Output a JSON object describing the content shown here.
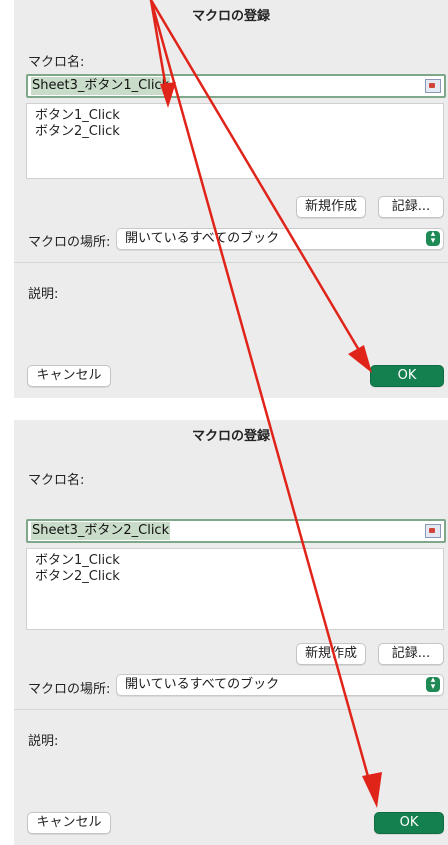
{
  "dialogs": [
    {
      "title": "マクロの登録",
      "macro_name_label": "マクロ名:",
      "macro_name_value": "Sheet3_ボタン1_Click",
      "macros": [
        "ボタン1_Click",
        "ボタン2_Click"
      ],
      "new_button": "新規作成",
      "record_button": "記録...",
      "location_label": "マクロの場所:",
      "location_value": "開いているすべてのブック",
      "description_label": "説明:",
      "cancel_button": "キャンセル",
      "ok_button": "OK"
    },
    {
      "title": "マクロの登録",
      "macro_name_label": "マクロ名:",
      "macro_name_value": "Sheet3_ボタン2_Click",
      "macros": [
        "ボタン1_Click",
        "ボタン2_Click"
      ],
      "new_button": "新規作成",
      "record_button": "記録...",
      "location_label": "マクロの場所:",
      "location_value": "開いているすべてのブック",
      "description_label": "説明:",
      "cancel_button": "キャンセル",
      "ok_button": "OK"
    }
  ],
  "colors": {
    "ok_green": "#15804f",
    "selection_green": "#c9dcc9",
    "annotation_red": "#e0241a"
  }
}
